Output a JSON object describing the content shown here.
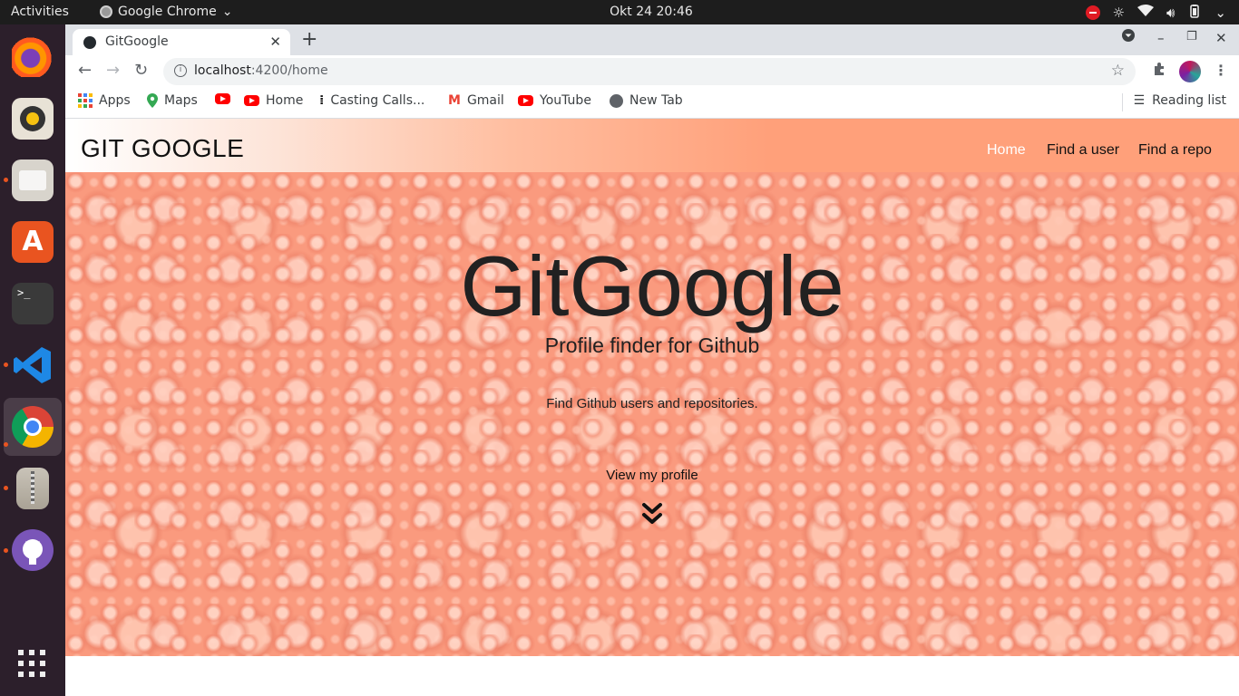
{
  "system_bar": {
    "activities": "Activities",
    "app_name": "Google Chrome",
    "clock": "Okt 24  20:46"
  },
  "dock": {
    "apps": [
      "firefox-icon",
      "rhythmbox-icon",
      "files-icon",
      "app-center-icon",
      "terminal-icon",
      "vscode-icon",
      "chrome-icon",
      "archive-icon",
      "github-desktop-icon",
      "show-apps-icon"
    ]
  },
  "browser": {
    "tab_title": "GitGoogle",
    "url_host": "localhost",
    "url_path": ":4200/home",
    "bookmarks": [
      "Apps",
      "Maps",
      "Home",
      "Casting Calls...",
      "Gmail",
      "YouTube",
      "New Tab"
    ],
    "reading_list": "Reading list"
  },
  "page": {
    "brand": "GIT GOOGLE",
    "nav": [
      "Home",
      "Find a user",
      "Find a repo"
    ],
    "hero": {
      "title": "GitGoogle",
      "subtitle": "Profile finder for Github",
      "description": "Find Github users and repositories.",
      "button": "View my profile"
    }
  },
  "colors": {
    "navbar_accent": "#ffa07a",
    "hero_background": "#fa9a7e",
    "active_nav": "#ffffff",
    "dock_bg": "#2c1f2b"
  }
}
